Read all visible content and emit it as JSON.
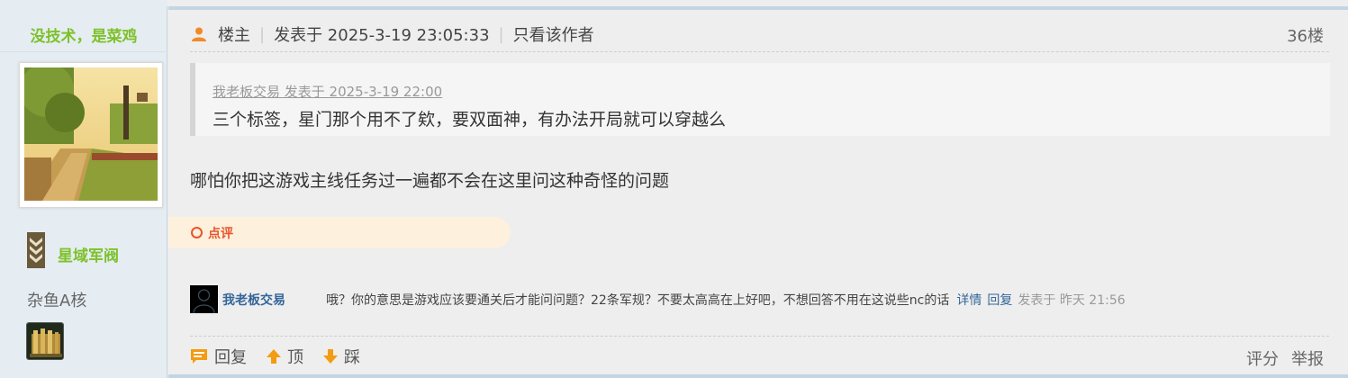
{
  "user": {
    "name": "没技术，是菜鸡",
    "group": "星域军阀",
    "rank": "杂鱼A核"
  },
  "post": {
    "role": "楼主",
    "posted": "发表于 2025-3-19 23:05:33",
    "only_author": "只看该作者",
    "floor": "36楼",
    "quote": {
      "author_line": "我老板交易 发表于 2025-3-19 22:00",
      "text": "三个标签，星门那个用不了欸，要双面神，有办法开局就可以穿越么"
    },
    "body": "哪怕你把这游戏主线任务过一遍都不会在这里问这种奇怪的问题"
  },
  "comment_tab": {
    "label": "点评"
  },
  "reply": {
    "user": "我老板交易",
    "text": "哦？你的意思是游戏应该要通关后才能问问题？22条军规？不要太高高在上好吧，不想回答不用在这说些nc的话",
    "detail": "详情",
    "reply": "回复",
    "time": "发表于 昨天 21:56"
  },
  "actions": {
    "reply": "回复",
    "up": "顶",
    "down": "踩",
    "rate": "评分",
    "report": "举报"
  },
  "colors": {
    "accent_green": "#7ec12b",
    "link_blue": "#336699",
    "comment_red": "#e8552b",
    "action_orange": "#f39c12"
  }
}
